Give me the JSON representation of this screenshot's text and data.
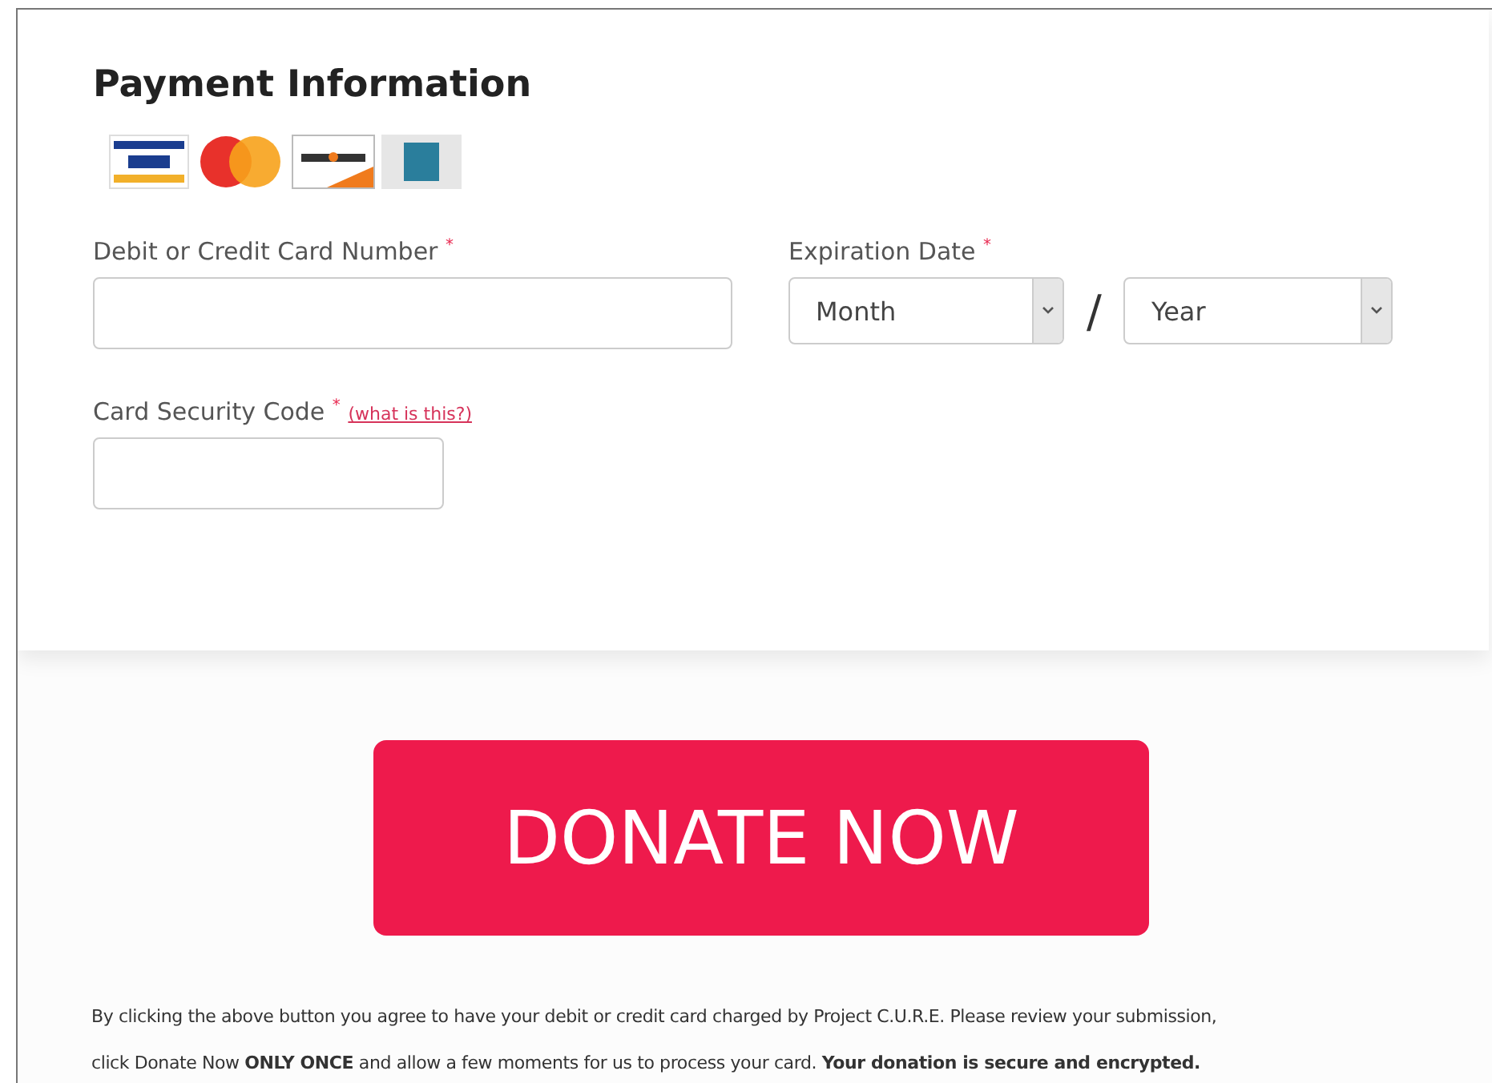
{
  "section": {
    "title": "Payment Information"
  },
  "card_brands": [
    {
      "kind": "visa"
    },
    {
      "kind": "mastercard"
    },
    {
      "kind": "discover"
    },
    {
      "kind": "amex"
    }
  ],
  "card_number": {
    "label": "Debit or Credit Card Number",
    "required_mark": "*"
  },
  "expiration": {
    "label": "Expiration Date",
    "required_mark": "*",
    "month": "Month",
    "separator": "/",
    "year": "Year"
  },
  "security_code": {
    "label": "Card Security Code",
    "required_mark": "*",
    "help_link": "(what is this?)"
  },
  "donate_button": "DONATE NOW",
  "disclaimer": [
    "By clicking the above button you agree to have your debit or credit card charged by Project C.U.R.E. Please review your submission,",
    "click Donate Now **ONLY ONCE** and allow a few moments for us to process your card. **Your donation is secure and encrypted.**"
  ]
}
